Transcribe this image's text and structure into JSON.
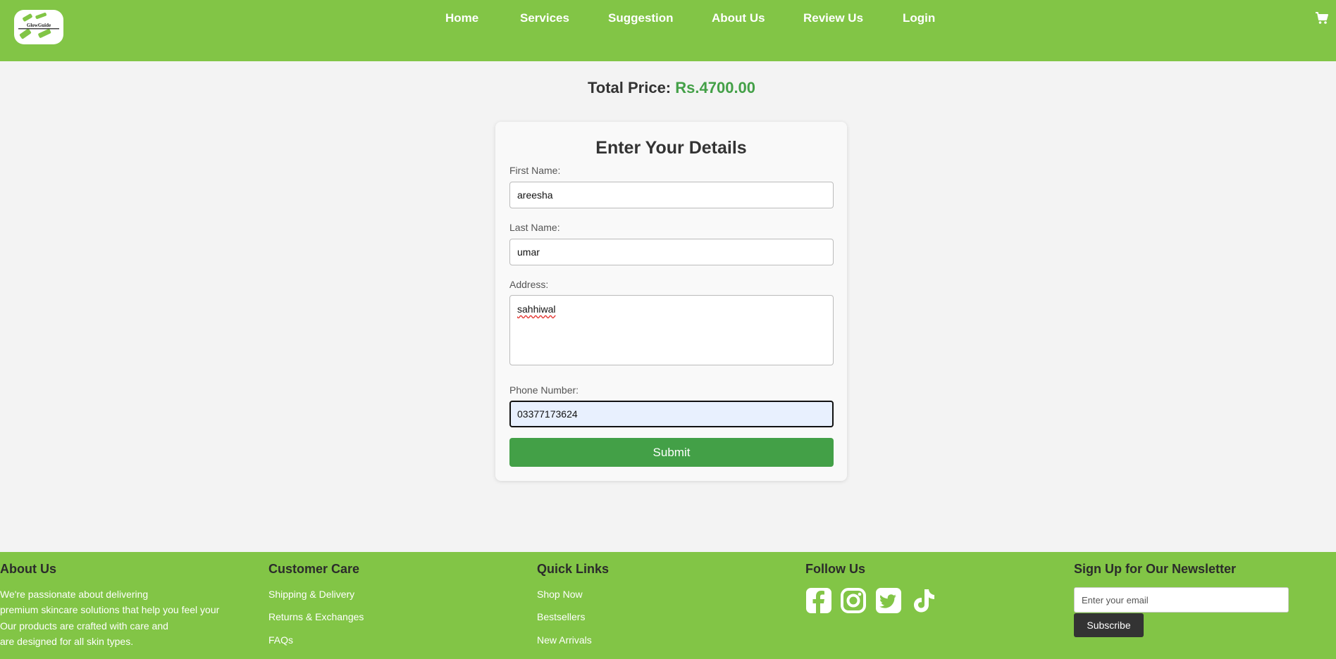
{
  "header": {
    "logo_text": "GlowGuide",
    "nav": [
      "Home",
      "Services",
      "Suggestion",
      "About Us",
      "Review Us",
      "Login"
    ],
    "cart_icon": "cart-icon",
    "background": "#82c546"
  },
  "summary": {
    "total_label": "Total Price:",
    "total_value": "Rs.4700.00",
    "accent": "#43a047"
  },
  "form": {
    "title": "Enter Your Details",
    "first_name_label": "First Name:",
    "first_name_value": "areesha",
    "last_name_label": "Last Name:",
    "last_name_value": "umar",
    "address_label": "Address:",
    "address_value": "sahhiwal",
    "phone_label": "Phone Number:",
    "phone_value": "03377173624",
    "submit_label": "Submit"
  },
  "footer": {
    "about": {
      "title": "About Us",
      "lines": [
        "We're passionate about delivering",
        "premium skincare solutions that help you feel your",
        "Our products are crafted with care and",
        "are designed for all skin types."
      ]
    },
    "care": {
      "title": "Customer Care",
      "links": [
        "Shipping & Delivery",
        "Returns & Exchanges",
        "FAQs"
      ]
    },
    "quick": {
      "title": "Quick Links",
      "links": [
        "Shop Now",
        "Bestsellers",
        "New Arrivals"
      ]
    },
    "follow": {
      "title": "Follow Us",
      "icons": [
        "facebook-icon",
        "instagram-icon",
        "twitter-icon",
        "tiktok-icon"
      ]
    },
    "newsletter": {
      "title": "Sign Up for Our Newsletter",
      "placeholder": "Enter your email",
      "button": "Subscribe"
    }
  }
}
